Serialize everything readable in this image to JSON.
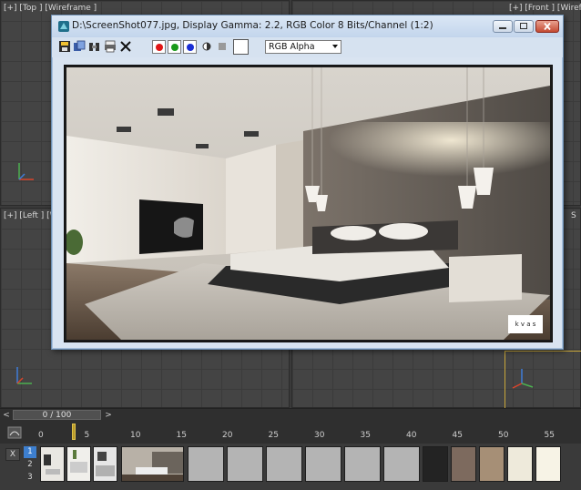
{
  "viewports": {
    "top": "[+] [Top ] [Wireframe ]",
    "front": "[+] [Front ] [Wirefra",
    "left": "[+] [Left ] [W",
    "persp_fragment": "S"
  },
  "render_window": {
    "title": "D:\\ScreenShot077.jpg, Display Gamma: 2.2, RGB Color 8 Bits/Channel (1:2)",
    "channel_select": "RGB Alpha",
    "swatch_color": "#ffffff",
    "channel_colors": {
      "red": "#e01515",
      "green": "#1a9a1a",
      "blue": "#1a2ed4"
    },
    "image_watermark": "k v a s"
  },
  "timeline": {
    "counter": "0 / 100",
    "ticks": [
      "0",
      "5",
      "10",
      "15",
      "20",
      "25",
      "30",
      "35",
      "40",
      "45",
      "50",
      "55"
    ]
  },
  "bottom_bar": {
    "x_label": "X",
    "rows": [
      "1",
      "2",
      "3"
    ],
    "slot_colors": [
      "#b4b4b4",
      "#b4b4b4",
      "#b4b4b4",
      "#b4b4b4",
      "#b4b4b4",
      "#b4b4b4",
      "#232323",
      "#7d6a5e",
      "#a68f76",
      "#eeeadb",
      "#f7f3e6"
    ]
  }
}
